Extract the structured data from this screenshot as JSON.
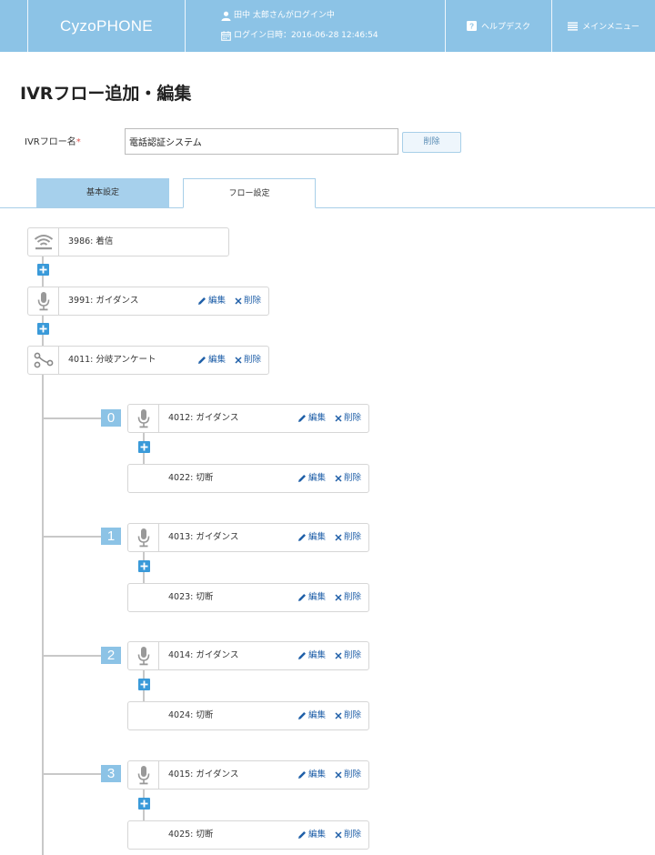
{
  "header": {
    "brand": "CyzoPHONE",
    "user_text": "田中 太郎さんがログイン中",
    "login_text": "ログイン日時：2016-06-28 12:46:54",
    "help_label": "ヘルプデスク",
    "menu_label": "メインメニュー"
  },
  "page": {
    "title": "IVRフロー追加・編集",
    "name_label": "IVRフロー名",
    "name_required_mark": "*",
    "name_value": "電話認証システム",
    "delete_button": "削除"
  },
  "tabs": [
    {
      "label": "基本設定",
      "active": false
    },
    {
      "label": "フロー設定",
      "active": true
    }
  ],
  "actions": {
    "edit": "編集",
    "delete": "削除"
  },
  "flow": {
    "main": [
      {
        "label": "3986: 着信",
        "icon": "wifi-icon"
      },
      {
        "label": "3991: ガイダンス",
        "icon": "microphone-icon"
      },
      {
        "label": "4011: 分岐アンケート",
        "icon": "branch-icon"
      }
    ],
    "branches": [
      {
        "num": "0",
        "guidance": "4012: ガイダンス",
        "hangup": "4022: 切断"
      },
      {
        "num": "1",
        "guidance": "4013: ガイダンス",
        "hangup": "4023: 切断"
      },
      {
        "num": "2",
        "guidance": "4014: ガイダンス",
        "hangup": "4024: 切断"
      },
      {
        "num": "3",
        "guidance": "4015: ガイダンス",
        "hangup": "4025: 切断"
      }
    ]
  },
  "colors": {
    "header_bg": "#8cc3e6",
    "link": "#1f5fa8",
    "plus": "#3a9ad9",
    "branch_num_bg": "#8cc3e6",
    "tab_inactive": "#a6d0ec"
  }
}
